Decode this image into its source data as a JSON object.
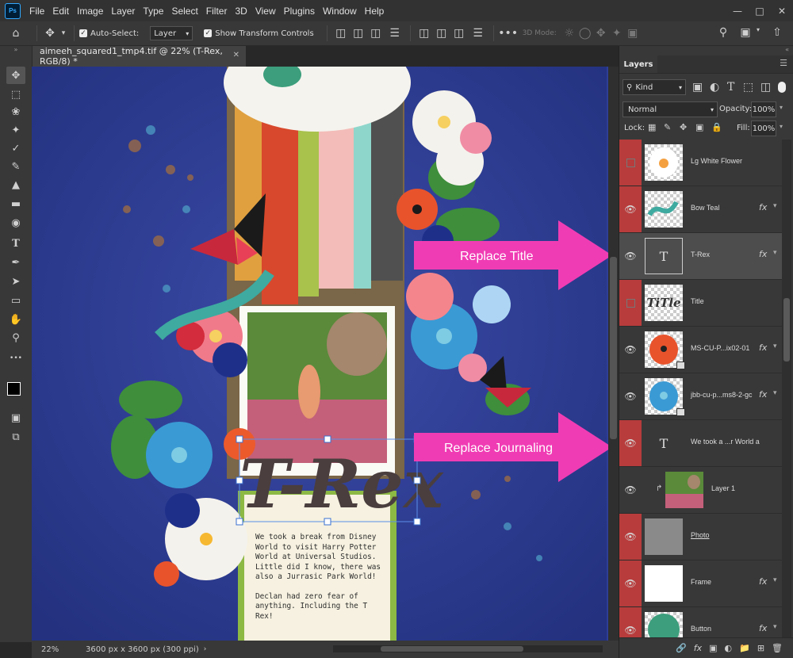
{
  "app": {
    "logo": "Ps"
  },
  "menu": [
    "File",
    "Edit",
    "Image",
    "Layer",
    "Type",
    "Select",
    "Filter",
    "3D",
    "View",
    "Plugins",
    "Window",
    "Help"
  ],
  "options_bar": {
    "auto_select_label": "Auto-Select:",
    "auto_select_value": "Layer",
    "show_transform_label": "Show Transform Controls",
    "mode_3d_label": "3D Mode:"
  },
  "document_tab": {
    "title": "aimeeh_squared1_tmp4.tif @ 22% (T-Rex, RGB/8) *"
  },
  "status": {
    "zoom": "22%",
    "doc_info": "3600 px x 3600 px (300 ppi)"
  },
  "canvas": {
    "title_art": "T-Rex",
    "journaling": "We took a break from Disney World to visit Harry Potter World at Universal Studios. Little did I know, there was also a Jurrasic Park World!",
    "journaling2": "Declan had zero fear of anything. Including the T Rex!",
    "callouts": [
      {
        "label": "Replace Title"
      },
      {
        "label": "Replace Journaling"
      }
    ]
  },
  "layers_panel": {
    "title": "Layers",
    "filter_kind": "Kind",
    "blend_mode": "Normal",
    "opacity_label": "Opacity:",
    "opacity_value": "100%",
    "lock_label": "Lock:",
    "fill_label": "Fill:",
    "fill_value": "100%",
    "layers": [
      {
        "name": "Lg White Flower",
        "visible": false,
        "fx": false
      },
      {
        "name": "Bow Teal",
        "visible": true,
        "fx": true
      },
      {
        "name": "T-Rex",
        "visible": true,
        "fx": true,
        "selected": true,
        "type_glyph": "T"
      },
      {
        "name": "Title",
        "visible": false,
        "fx": false,
        "thumb_text": "TiTle"
      },
      {
        "name": "MS-CU-P...ix02-01",
        "visible": true,
        "fx": true
      },
      {
        "name": "jbb-cu-p...ms8-2-gc",
        "visible": true,
        "fx": true
      },
      {
        "name": "We took a ...r World a",
        "visible": true,
        "fx": false,
        "type_glyph": "T"
      },
      {
        "name": "Layer 1",
        "visible": true,
        "fx": false
      },
      {
        "name": "Photo",
        "visible": true,
        "fx": false
      },
      {
        "name": "Frame",
        "visible": true,
        "fx": true
      },
      {
        "name": "Button",
        "visible": true,
        "fx": true
      }
    ],
    "fx_label": "fx"
  },
  "colors": {
    "accent_red": "#b83c3c",
    "callout_pink": "#f03cb4",
    "canvas_blue": "#2e3e97"
  }
}
